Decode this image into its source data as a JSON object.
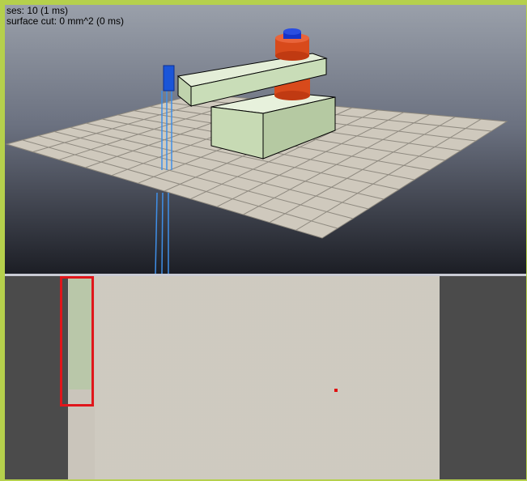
{
  "viewport": {
    "stats_line_1": "ses: 10 (1 ms)",
    "stats_line_2": "surface cut: 0 mm^2 (0 ms)"
  },
  "colors": {
    "frame_border": "#b5d04c",
    "floor_tile_light": "#d9d4c9",
    "floor_tile_dark": "#c2bdb2",
    "block_green": "#c9ddb8",
    "joint_orange": "#d84a1b",
    "cap_blue": "#1534c8",
    "tool_blue": "#1a55d8",
    "beam_blue": "#3f8fe8",
    "marker_red": "#e0161b",
    "camera_background": "#cdc8be",
    "camera_side": "#4b4b4b"
  },
  "icons": {
    "scene": "robot-arm-scene"
  }
}
